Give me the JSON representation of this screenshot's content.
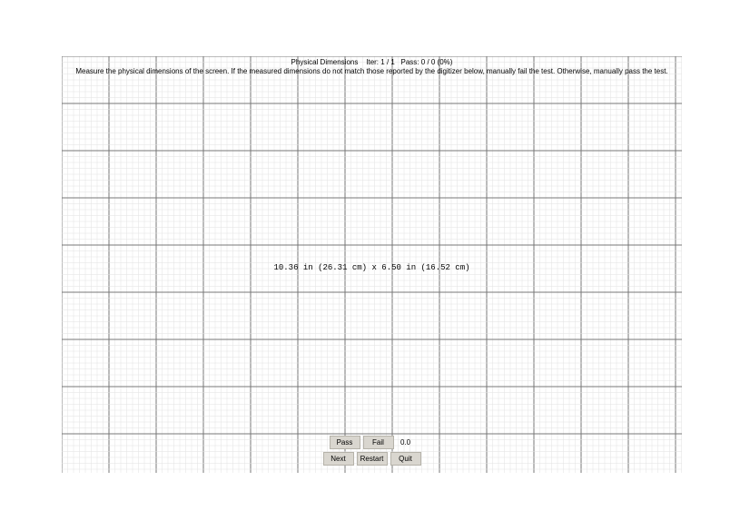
{
  "header": {
    "title": "Physical Dimensions",
    "iter_label": "Iter:",
    "iter": "1 / 1",
    "pass_label": "Pass:",
    "pass_count": "0 / 0 (0%)",
    "instruction": "Measure the physical dimensions of the screen. If the measured dimensions do not match those reported by the digitizer below, manually fail the test. Otherwise, manually pass the test."
  },
  "measurement": {
    "text": "10.36 in (26.31 cm) x 6.50 in (16.52 cm)"
  },
  "controls": {
    "pass": "Pass",
    "fail": "Fail",
    "value": "0.0",
    "next": "Next",
    "restart": "Restart",
    "quit": "Quit"
  },
  "grid": {
    "minor_spacing_px": 6.5,
    "major_every": 8,
    "minor_color": "#e2e2e2",
    "major_color": "#777777",
    "minor_width": 0.5,
    "major_width": 1
  }
}
